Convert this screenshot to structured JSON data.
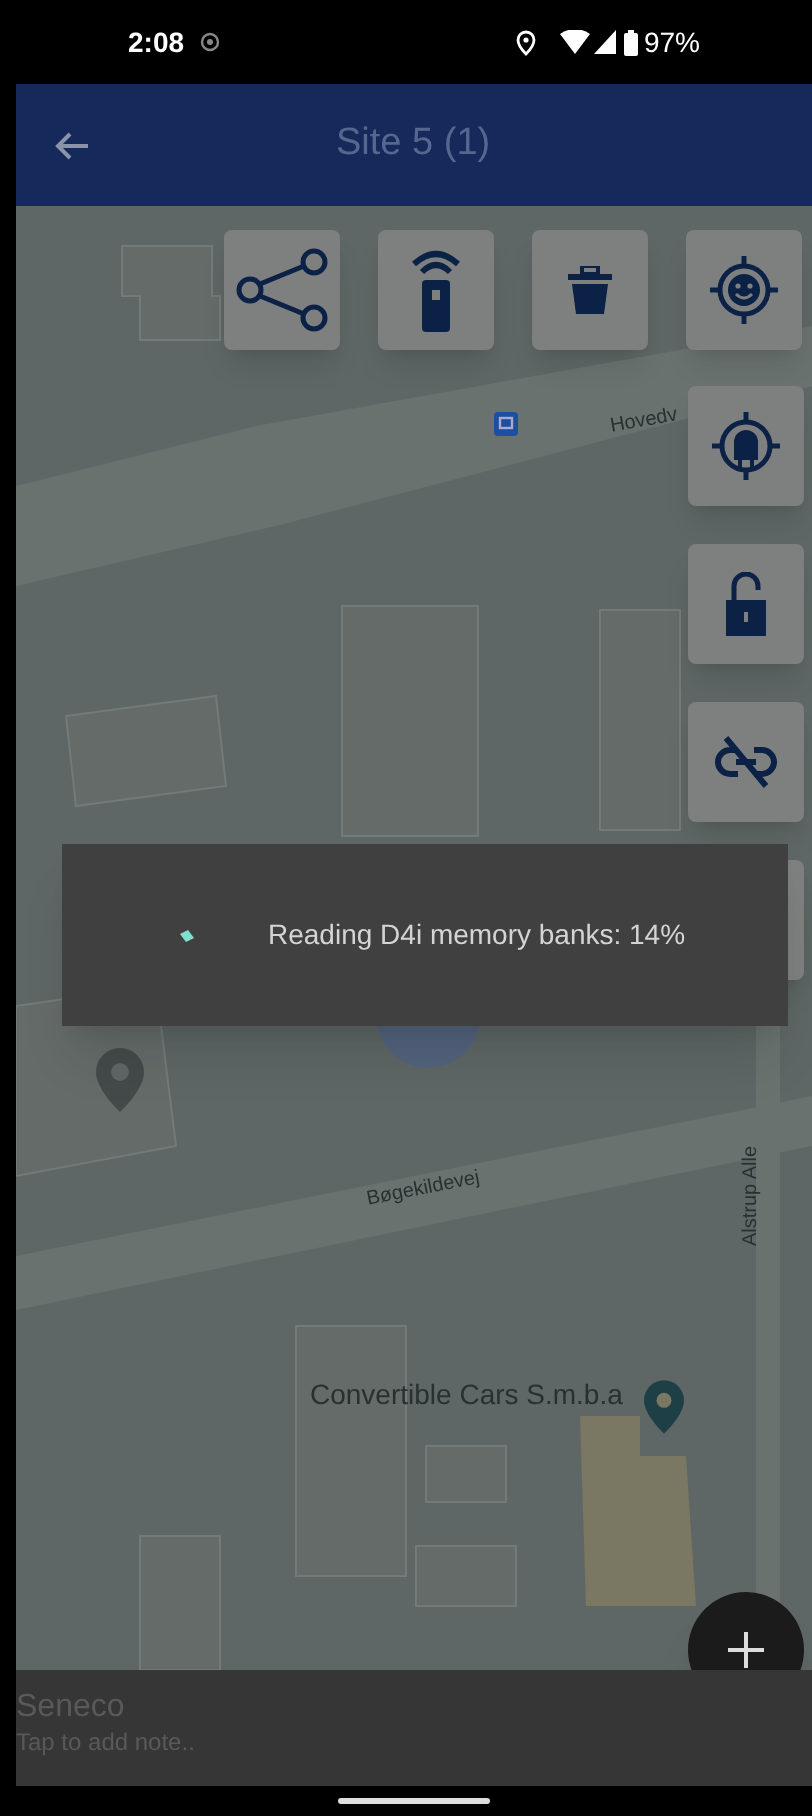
{
  "status_bar": {
    "time": "2:08",
    "battery": "97%"
  },
  "app_bar": {
    "title": "Site 5 (1)"
  },
  "map": {
    "labels": [
      {
        "kind": "street",
        "text": "Hovedv"
      },
      {
        "kind": "street",
        "text": "Bøgekildevej"
      },
      {
        "kind": "street_vertical",
        "text": "Alstrup Alle"
      },
      {
        "kind": "place",
        "text": "Convertible Cars S.m.b.a"
      }
    ]
  },
  "progress_dialog": {
    "message": "Reading D4i memory banks: 14%"
  },
  "note_bar": {
    "title": "Seneco",
    "hint": "Tap to add note.."
  }
}
